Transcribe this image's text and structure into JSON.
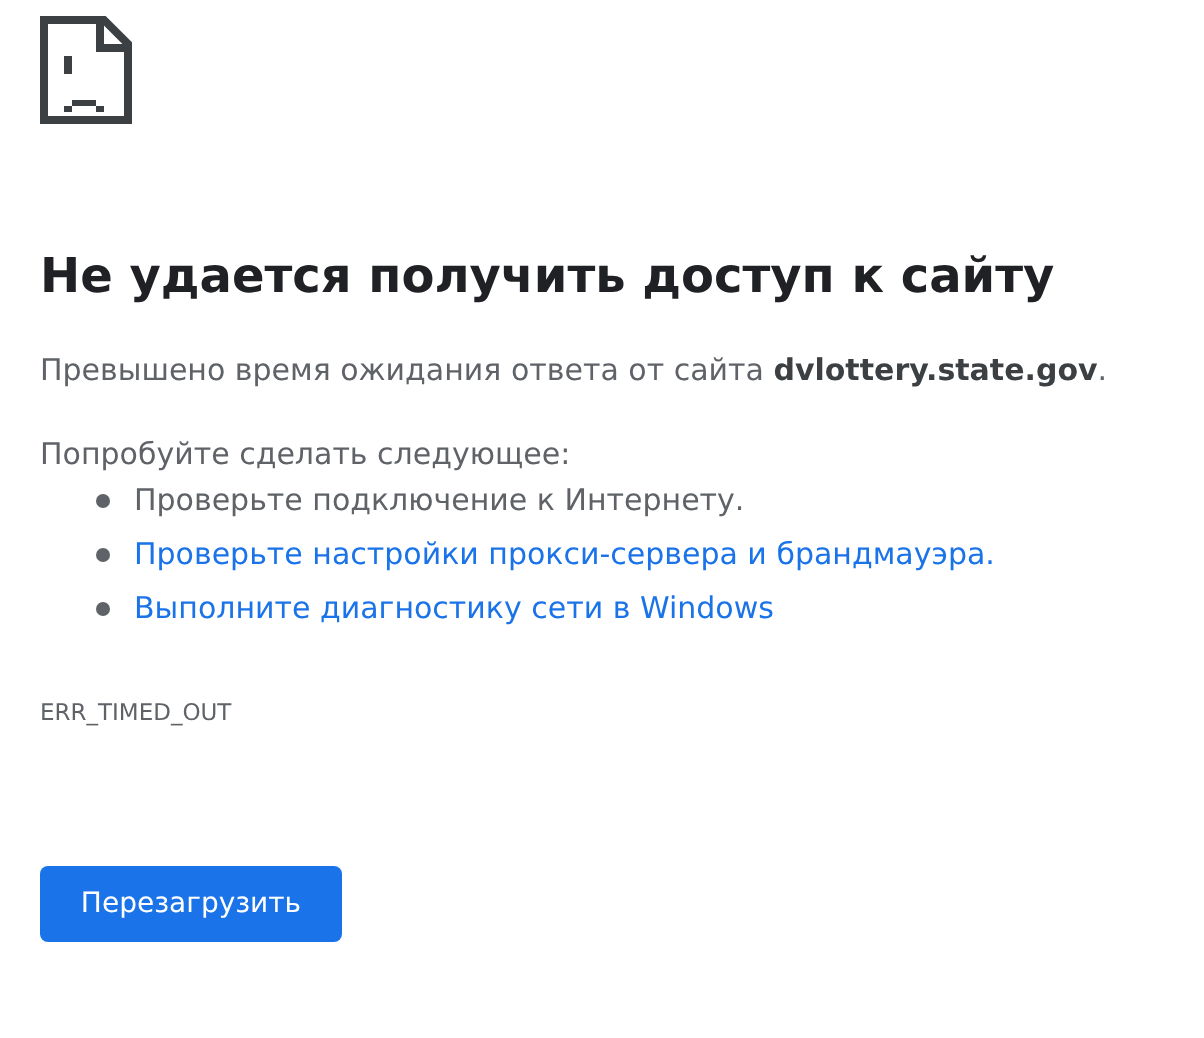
{
  "heading": "Не удается получить доступ к сайту",
  "summary": "Превышено время ожидания ответа от сайта **dvlottery.state.gov**.",
  "suggestions_label": "Попробуйте сделать следующее:",
  "suggestions": [
    {
      "kind": "text",
      "text": "Проверьте подключение к Интернету."
    },
    {
      "kind": "link",
      "text": "Проверьте настройки прокси-сервера и брандмауэра."
    },
    {
      "kind": "link",
      "text": "Выполните диагностику сети в Windows"
    }
  ],
  "error_code": "ERR_TIMED_OUT",
  "reload_button": "Перезагрузить"
}
